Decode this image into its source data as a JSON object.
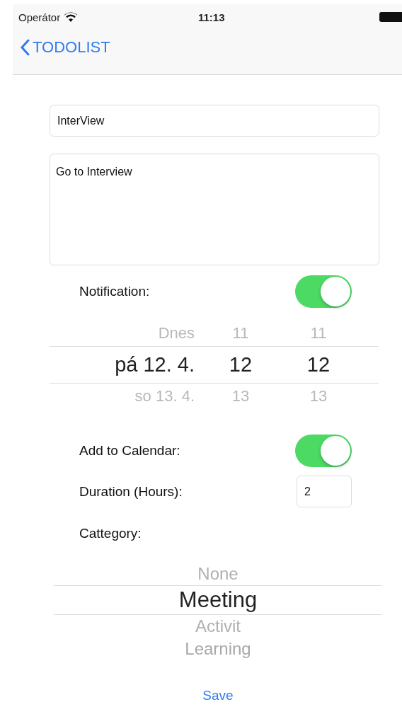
{
  "status_bar": {
    "carrier": "Operátor",
    "time": "11:13"
  },
  "nav": {
    "back_label": "TODOLIST"
  },
  "title_field": {
    "value": "InterView"
  },
  "notes_field": {
    "value": "Go to Interview"
  },
  "notification": {
    "label": "Notification:",
    "on": true
  },
  "date_picker": {
    "columns": [
      {
        "items": [
          {
            "label": "Dnes",
            "selected": false
          },
          {
            "label": "pá 12. 4.",
            "selected": true
          },
          {
            "label": "so 13. 4.",
            "selected": false
          }
        ]
      },
      {
        "items": [
          {
            "label": "11",
            "selected": false
          },
          {
            "label": "12",
            "selected": true
          },
          {
            "label": "13",
            "selected": false
          }
        ]
      },
      {
        "items": [
          {
            "label": "11",
            "selected": false
          },
          {
            "label": "12",
            "selected": true
          },
          {
            "label": "13",
            "selected": false
          }
        ]
      }
    ]
  },
  "calendar": {
    "label": "Add to Calendar:",
    "on": true
  },
  "duration": {
    "label": "Duration (Hours):",
    "value": "2"
  },
  "category": {
    "label": "Cattegory:",
    "items": [
      {
        "label": "None",
        "selected": false
      },
      {
        "label": "Meeting",
        "selected": true
      },
      {
        "label": "Activit",
        "selected": false
      },
      {
        "label": "Learning",
        "selected": false
      }
    ]
  },
  "save_label": "Save"
}
